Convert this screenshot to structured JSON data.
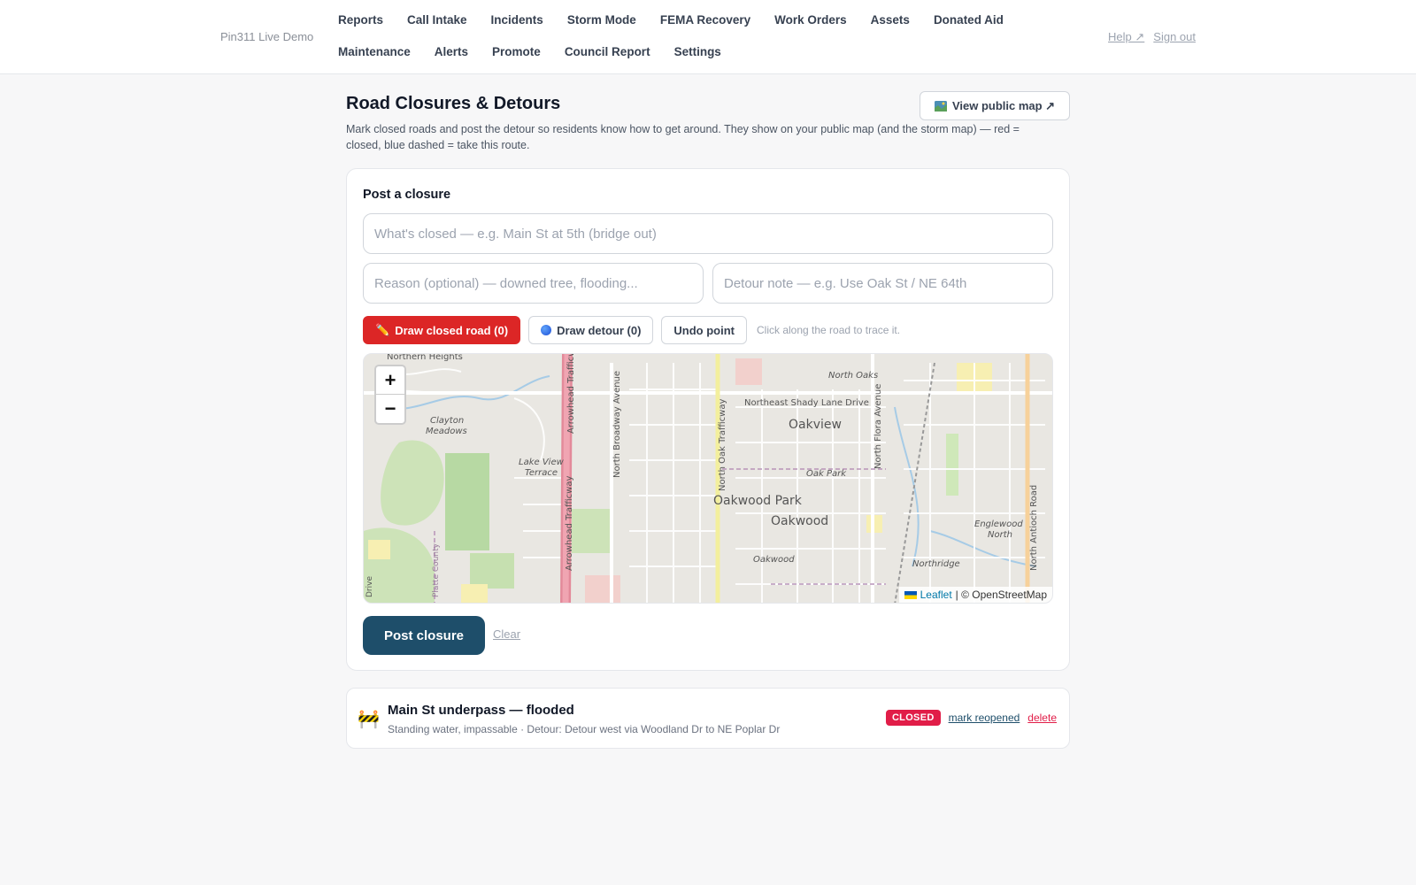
{
  "brand": "Pin311 Live Demo",
  "nav": {
    "row1": [
      "Reports",
      "Call Intake",
      "Incidents",
      "Storm Mode",
      "FEMA Recovery",
      "Work Orders",
      "Assets",
      "Donated Aid"
    ],
    "row2": [
      "Maintenance",
      "Alerts",
      "Promote",
      "Council Report",
      "Settings"
    ]
  },
  "top_links": {
    "help": "Help ↗",
    "signout": "Sign out"
  },
  "page": {
    "title": "Road Closures & Detours",
    "description": "Mark closed roads and post the detour so residents know how to get around. They show on your public map (and the storm map) — red = closed, blue dashed = take this route.",
    "view_map_label": "View public map ↗"
  },
  "form": {
    "title": "Post a closure",
    "what_placeholder": "What's closed — e.g. Main St at 5th (bridge out)",
    "reason_placeholder": "Reason (optional) — downed tree, flooding...",
    "detour_placeholder": "Detour note — e.g. Use Oak St / NE 64th",
    "draw_closed_label": "Draw closed road (0)",
    "draw_detour_label": "Draw detour (0)",
    "undo_label": "Undo point",
    "hint": "Click along the road to trace it.",
    "post_label": "Post closure",
    "clear_label": "Clear"
  },
  "map": {
    "zoom_in": "+",
    "zoom_out": "−",
    "attribution_leaflet": "Leaflet",
    "attribution_osm": "| © OpenStreetMap",
    "labels": {
      "northern_heights": "Northern Heights",
      "clayton": "Clayton",
      "meadows": "Meadows",
      "lake_view": "Lake View",
      "terrace": "Terrace",
      "arrowhead_top": "Arrowhead Trafficw",
      "arrowhead_bottom": "Arrowhead Trafficway",
      "n_broadway": "North Broadway Avenue",
      "n_oak": "North Oak Trafficway",
      "n_flora": "North Flora Avenue",
      "n_antioch": "North Antioch Road",
      "north_oaks": "North Oaks",
      "shady_lane": "Northeast Shady Lane Drive",
      "oakview": "Oakview",
      "oak_park": "Oak Park",
      "oakwood_park": "Oakwood Park",
      "oakwood": "Oakwood",
      "oakwood_small": "Oakwood",
      "englewood": "Englewood",
      "north": "North",
      "northridge": "Northridge",
      "platte_county": "Platte County",
      "drive": "Drive"
    }
  },
  "closures": [
    {
      "icon": "🚧",
      "title": "Main St underpass — flooded",
      "subtitle": "Standing water, impassable · Detour: Detour west via Woodland Dr to NE Poplar Dr",
      "status": "CLOSED",
      "reopen_label": "mark reopened",
      "delete_label": "delete"
    }
  ],
  "colors": {
    "primary": "#1e4e6a",
    "danger": "#dc2626",
    "badge": "#e11d48"
  },
  "icons": {
    "view_map": "map-icon",
    "draw_closed": "pencil-icon",
    "draw_detour": "blue-dot-icon",
    "closure": "construction-barrier-icon"
  }
}
